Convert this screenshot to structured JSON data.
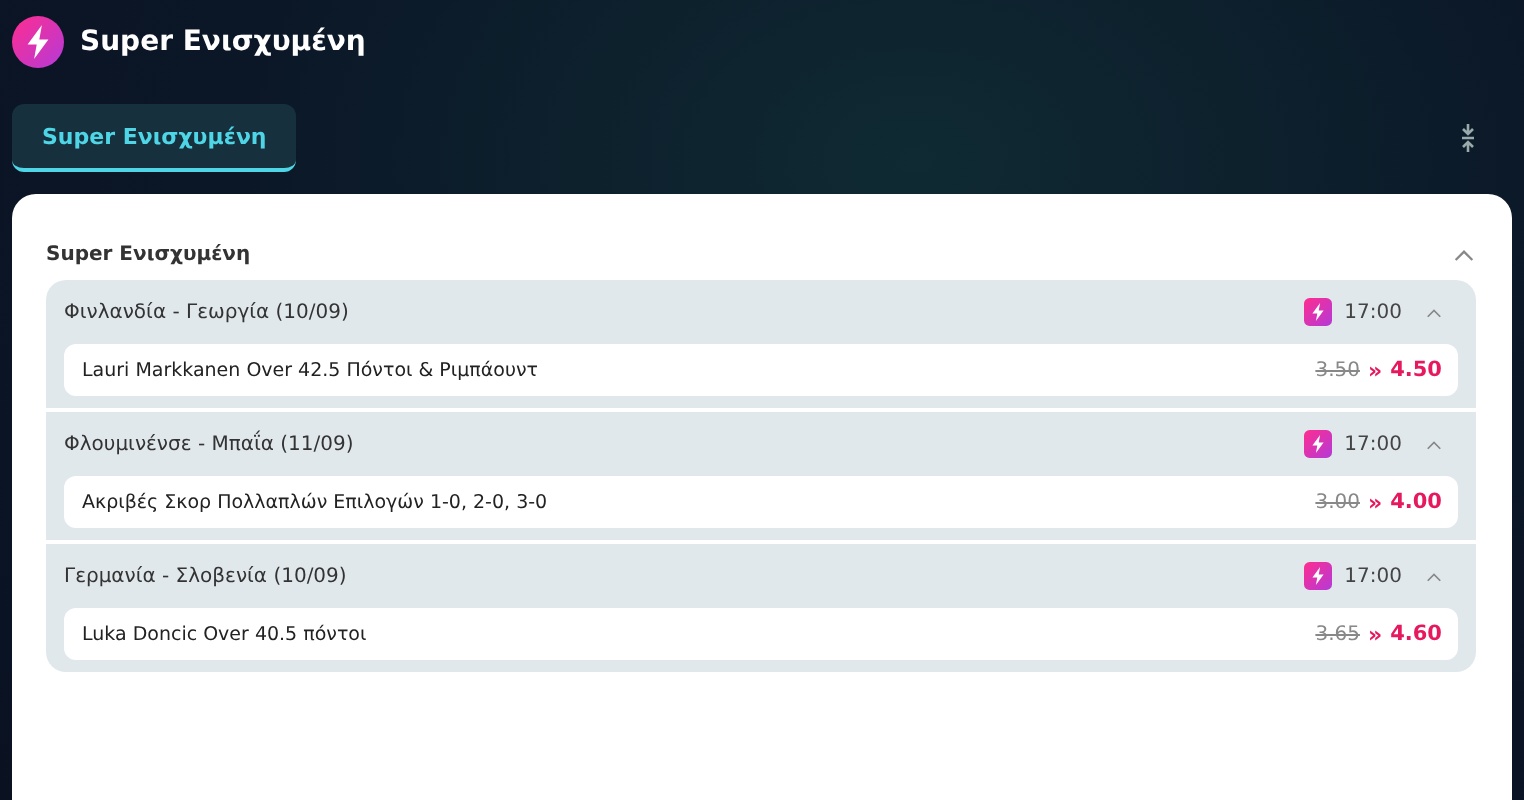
{
  "header": {
    "title": "Super Ενισχυμένη"
  },
  "tabs": [
    {
      "label": "Super Ενισχυμένη",
      "selected": true
    }
  ],
  "section": {
    "title": "Super Ενισχυμένη",
    "expanded": true,
    "events": [
      {
        "name": "Φινλανδία - Γεωργία (10/09)",
        "time": "17:00",
        "expanded": true,
        "bet": {
          "label": "Lauri Markkanen Over 42.5 Πόντοι & Ριμπάουντ",
          "old_odds": "3.50",
          "arrow": "»",
          "new_odds": "4.50"
        }
      },
      {
        "name": "Φλουμινένσε - Μπαΐα (11/09)",
        "time": "17:00",
        "expanded": true,
        "bet": {
          "label": "Ακριβές Σκορ Πολλαπλών Επιλογών 1-0, 2-0, 3-0",
          "old_odds": "3.00",
          "arrow": "»",
          "new_odds": "4.00"
        }
      },
      {
        "name": "Γερμανία - Σλοβενία (10/09)",
        "time": "17:00",
        "expanded": true,
        "bet": {
          "label": "Luka Doncic Over 40.5 πόντοι",
          "old_odds": "3.65",
          "arrow": "»",
          "new_odds": "4.60"
        }
      }
    ]
  }
}
